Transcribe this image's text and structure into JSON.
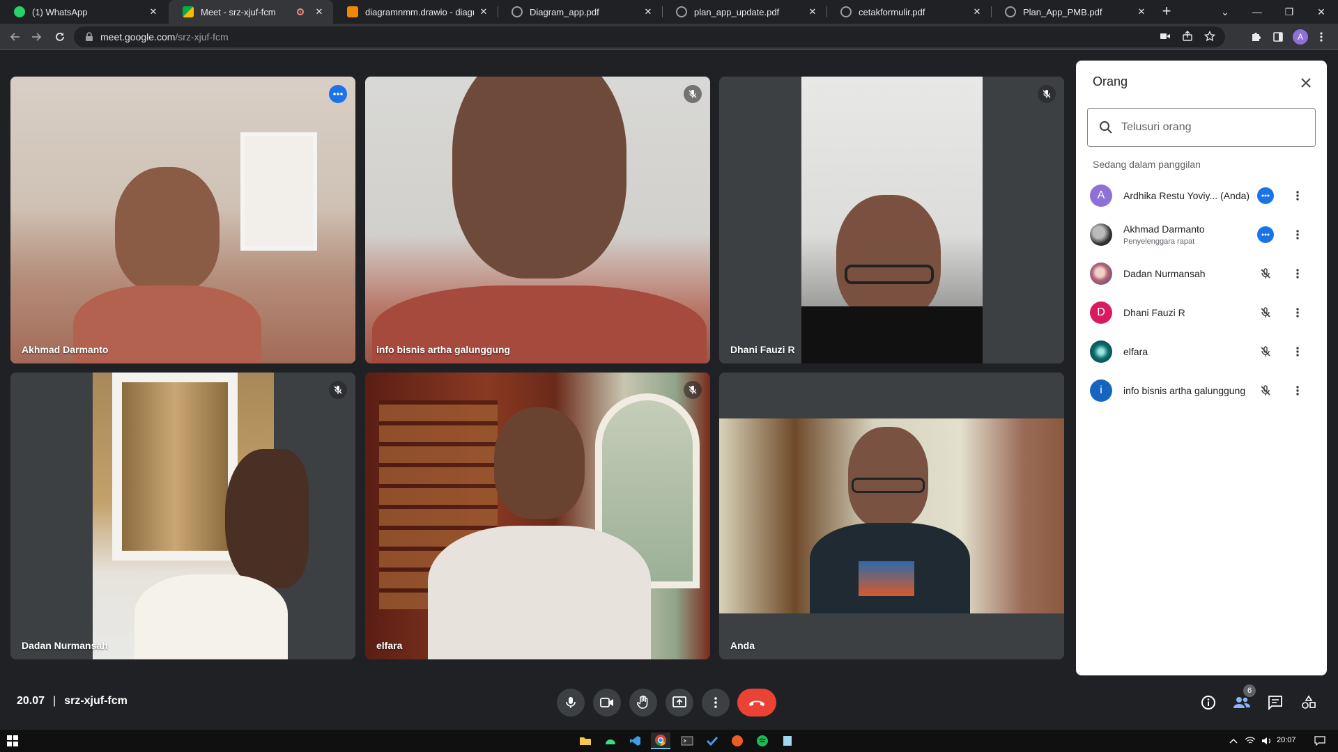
{
  "browser": {
    "tabs": [
      {
        "title": "(1) WhatsApp",
        "icon": "whatsapp-icon",
        "color": "#25d366"
      },
      {
        "title": "Meet - srz-xjuf-fcm",
        "icon": "google-meet-icon",
        "color": "#00897b"
      },
      {
        "title": "diagramnmm.drawio - diagrams.net",
        "icon": "drawio-icon",
        "color": "#f08705"
      },
      {
        "title": "Diagram_app.pdf",
        "icon": "globe-icon",
        "color": "#9aa0a6"
      },
      {
        "title": "plan_app_update.pdf",
        "icon": "globe-icon",
        "color": "#9aa0a6"
      },
      {
        "title": "cetakformulir.pdf",
        "icon": "globe-icon",
        "color": "#9aa0a6"
      },
      {
        "title": "Plan_App_PMB.pdf",
        "icon": "globe-icon",
        "color": "#9aa0a6"
      }
    ],
    "url_host": "meet.google.com",
    "url_path": "/srz-xjuf-fcm",
    "profile_initial": "A"
  },
  "meeting": {
    "time": "20.07",
    "code": "srz-xjuf-fcm",
    "participant_count": "6",
    "tiles": [
      {
        "name": "Akhmad Darmanto",
        "status": "speaking-more-icon"
      },
      {
        "name": "info bisnis artha galunggung",
        "status": "mic-off-icon"
      },
      {
        "name": "Dhani Fauzi R",
        "status": "mic-off-icon"
      },
      {
        "name": "Dadan Nurmansah",
        "status": "mic-off-icon"
      },
      {
        "name": "elfara",
        "status": "mic-off-icon"
      },
      {
        "name": "Anda",
        "status": ""
      }
    ]
  },
  "people_panel": {
    "title": "Orang",
    "search_placeholder": "Telusuri orang",
    "section_label": "Sedang dalam panggilan",
    "people": [
      {
        "name": "Ardhika Restu Yoviy...",
        "suffix": "(Anda)",
        "sub": "",
        "initial": "A",
        "avatar_color": "#8e71d6",
        "status": "more-talking-icon"
      },
      {
        "name": "Akhmad Darmanto",
        "suffix": "",
        "sub": "Penyelenggara rapat",
        "initial": "",
        "avatar_color": "#3c4043",
        "status": "more-talking-icon"
      },
      {
        "name": "Dadan Nurmansah",
        "suffix": "",
        "sub": "",
        "initial": "",
        "avatar_color": "#b56576",
        "status": "mic-off-icon"
      },
      {
        "name": "Dhani Fauzi R",
        "suffix": "",
        "sub": "",
        "initial": "D",
        "avatar_color": "#d81b60",
        "status": "mic-off-icon"
      },
      {
        "name": "elfara",
        "suffix": "",
        "sub": "",
        "initial": "",
        "avatar_color": "#0b6e70",
        "status": "mic-off-icon"
      },
      {
        "name": "info bisnis artha galunggung",
        "suffix": "",
        "sub": "",
        "initial": "i",
        "avatar_color": "#1565c0",
        "status": "mic-off-icon"
      }
    ]
  },
  "taskbar": {
    "clock": "20:07"
  }
}
